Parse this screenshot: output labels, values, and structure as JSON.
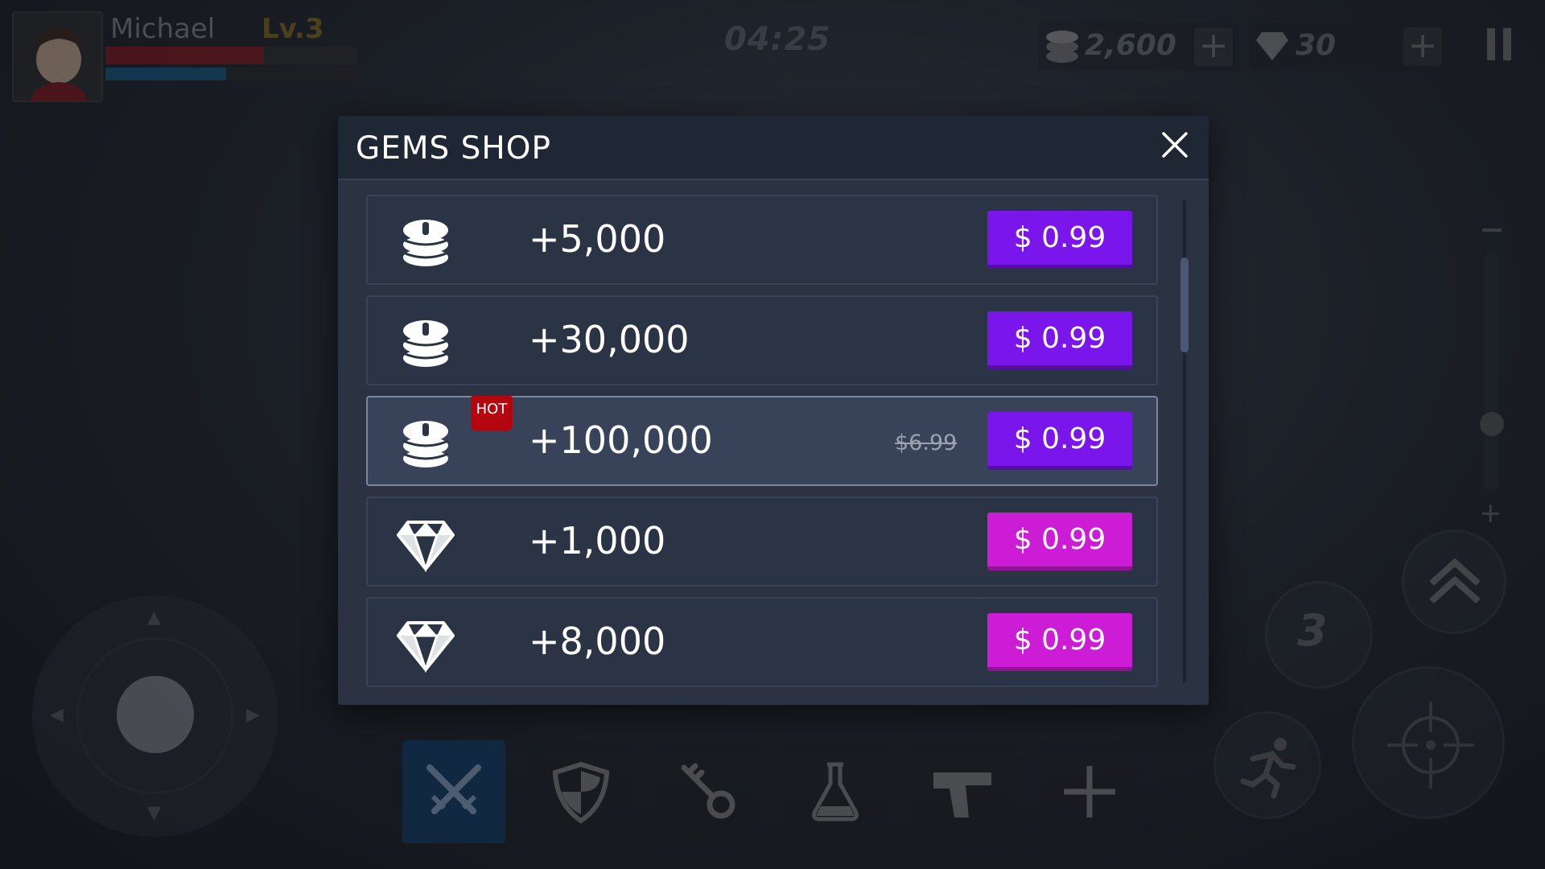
{
  "hud": {
    "player_name": "Michael",
    "player_level": "Lv.3",
    "hp_fraction": 0.63,
    "mp_fraction": 0.48,
    "timer": "04:25",
    "coins": "2,600",
    "gems": "30",
    "ability_charge": "3"
  },
  "dialog": {
    "title": "GEMS SHOP",
    "hot_label": "HOT",
    "items": [
      {
        "type": "coin",
        "amount": "+5,000",
        "price": "$ 0.99",
        "old_price": "",
        "hot": false
      },
      {
        "type": "coin",
        "amount": "+30,000",
        "price": "$ 0.99",
        "old_price": "",
        "hot": false
      },
      {
        "type": "coin",
        "amount": "+100,000",
        "price": "$ 0.99",
        "old_price": "$6.99",
        "hot": true
      },
      {
        "type": "gem",
        "amount": "+1,000",
        "price": "$ 0.99",
        "old_price": "",
        "hot": false
      },
      {
        "type": "gem",
        "amount": "+8,000",
        "price": "$ 0.99",
        "old_price": "",
        "hot": false
      }
    ]
  },
  "colors": {
    "coin_button": "#7a16ec",
    "gem_button": "#cd1cd5",
    "hot_badge": "#b3060f",
    "dialog_bg": "#2b3342"
  },
  "icons": {
    "coin": "coin-stack-icon",
    "gem": "diamond-icon",
    "close": "close-icon"
  }
}
